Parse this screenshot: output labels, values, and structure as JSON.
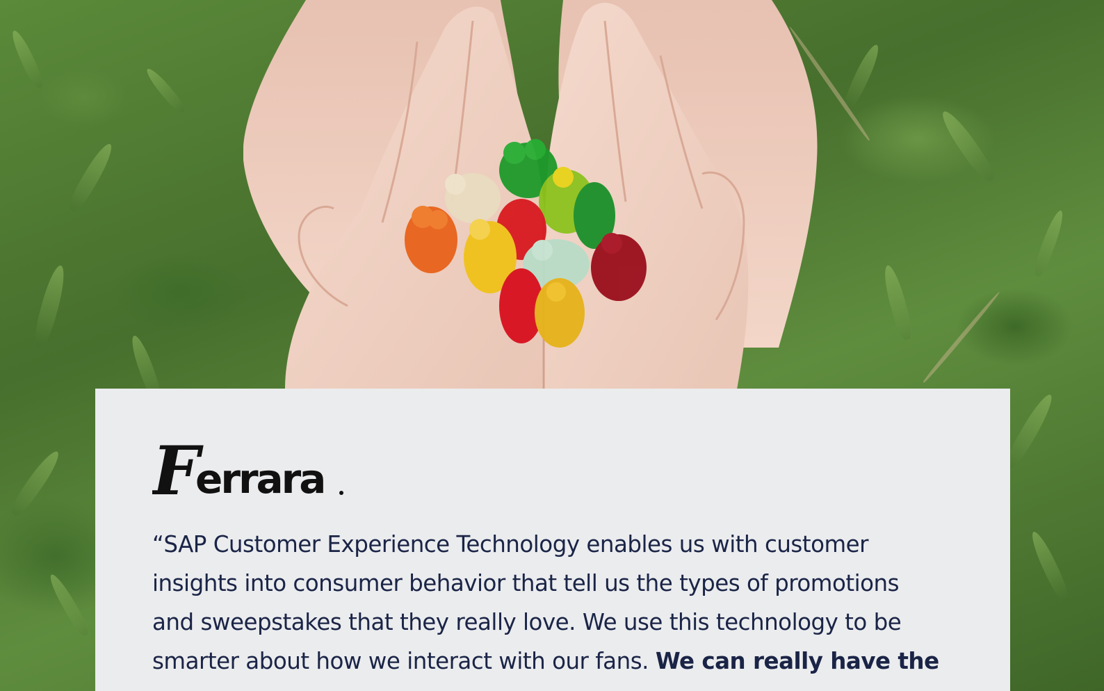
{
  "hero": {
    "image_description_icon": "hands-holding-gummy-bears-photo",
    "colors": {
      "grass": "#4f7d33",
      "skin": "#f0cdbd",
      "card_bg": "#ebecee",
      "text": "#1a2446"
    }
  },
  "testimonial": {
    "logo_text": "Ferrara",
    "quote_regular": "“SAP Customer Experience Technology enables us with customer insights into consumer behavior that tell us the types of promotions and sweepstakes that they really love. We use this technology to be smarter about how we interact with our fans.",
    "quote_bold": "We can really have the"
  }
}
